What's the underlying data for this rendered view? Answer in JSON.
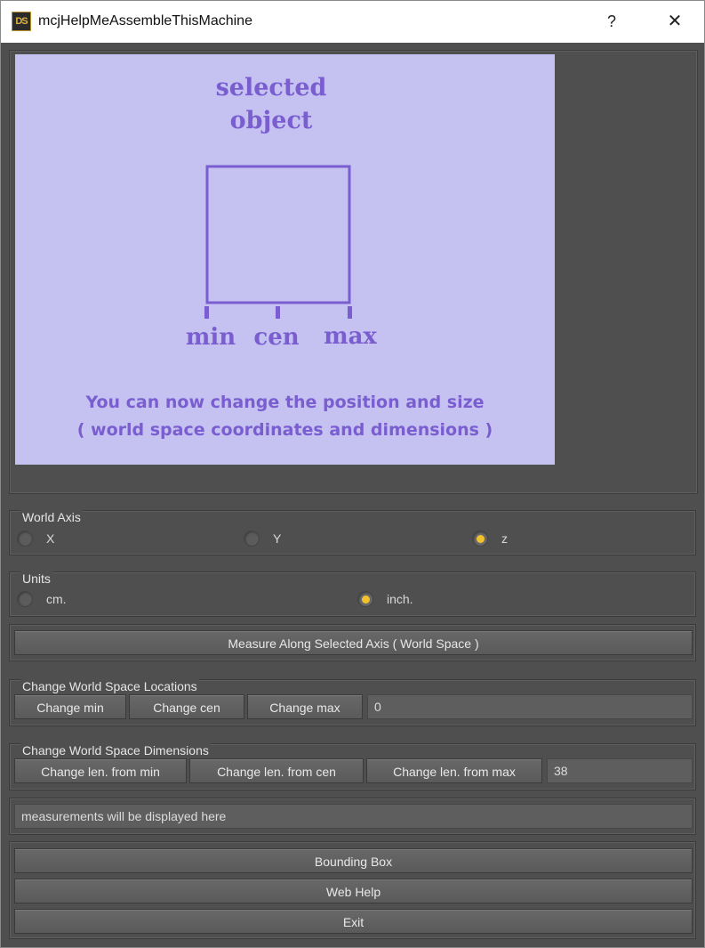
{
  "window": {
    "icon_text": "DS",
    "title": "mcjHelpMeAssembleThisMachine",
    "help_glyph": "?",
    "close_glyph": "✕"
  },
  "illustration": {
    "heading_line1": "selected",
    "heading_line2": "object",
    "label_min": "min",
    "label_cen": "cen",
    "label_max": "max",
    "message_line1": "You can now change the position and size",
    "message_line2": "( world space coordinates and dimensions )"
  },
  "world_axis": {
    "label": "World Axis",
    "options": [
      "X",
      "Y",
      "z"
    ],
    "selected": "z"
  },
  "units": {
    "label": "Units",
    "options": [
      "cm.",
      "inch."
    ],
    "selected": "inch."
  },
  "measure_button": "Measure Along Selected Axis ( World Space )",
  "locations": {
    "label": "Change World Space Locations",
    "buttons": [
      "Change min",
      "Change cen",
      "Change max"
    ],
    "value": "0"
  },
  "dimensions": {
    "label": "Change World Space Dimensions",
    "buttons": [
      "Change len. from min",
      "Change len. from cen",
      "Change len. from max"
    ],
    "value": "38"
  },
  "measurements": {
    "text": "measurements will be displayed here"
  },
  "footer": {
    "bounding_box": "Bounding Box",
    "web_help": "Web Help",
    "exit": "Exit"
  },
  "colors": {
    "accent": "#f2c12e",
    "illustration_bg": "#c5c2f2",
    "illustration_ink": "#7a5ed0"
  }
}
